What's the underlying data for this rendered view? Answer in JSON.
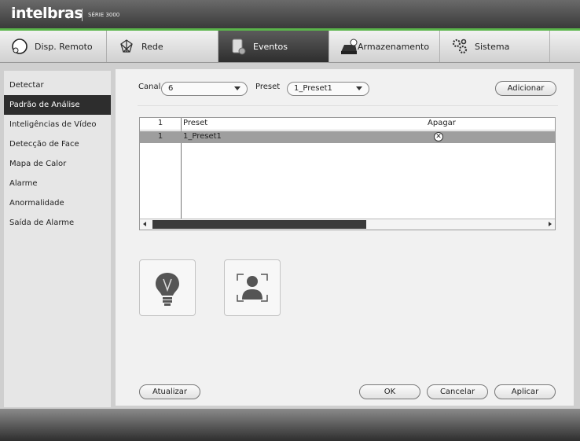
{
  "header": {
    "brand": "intelbras",
    "series": "SÉRIE 3000"
  },
  "tabs": [
    {
      "label": "Disp. Remoto",
      "icon": "remote-device-icon"
    },
    {
      "label": "Rede",
      "icon": "network-icon"
    },
    {
      "label": "Eventos",
      "icon": "events-icon"
    },
    {
      "label": "Armazenamento",
      "icon": "storage-icon"
    },
    {
      "label": "Sistema",
      "icon": "gears-icon"
    }
  ],
  "active_tab": "Eventos",
  "sidebar": {
    "items": [
      {
        "label": "Detectar"
      },
      {
        "label": "Padrão de Análise"
      },
      {
        "label": "Inteligências de Vídeo"
      },
      {
        "label": "Detecção de Face"
      },
      {
        "label": "Mapa de Calor"
      },
      {
        "label": "Alarme"
      },
      {
        "label": "Anormalidade"
      },
      {
        "label": "Saída de Alarme"
      }
    ],
    "active": "Padrão de Análise"
  },
  "form": {
    "canal_label": "Canal",
    "canal_value": "6",
    "preset_label": "Preset",
    "preset_value": "1_Preset1",
    "add_button": "Adicionar"
  },
  "table": {
    "headers": {
      "index": "1",
      "preset": "Preset",
      "delete": "Apagar"
    },
    "rows": [
      {
        "index": "1",
        "preset": "1_Preset1"
      }
    ]
  },
  "buttons": {
    "refresh": "Atualizar",
    "ok": "OK",
    "cancel": "Cancelar",
    "apply": "Aplicar"
  },
  "colors": {
    "accent": "#5ab44a",
    "active_tab": "#3a3a3a",
    "selected_row": "#9e9e9e"
  }
}
